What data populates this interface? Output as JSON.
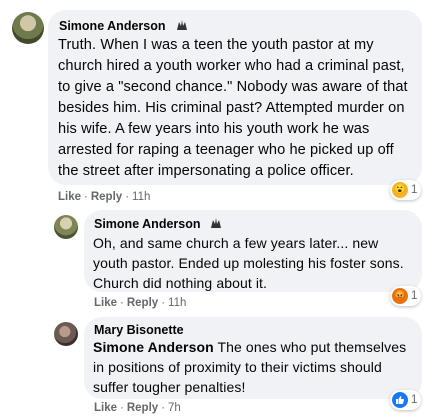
{
  "comments": [
    {
      "author": "Simone Anderson",
      "text": "Truth. When I was a teen the youth pastor at my church hired a youth worker who had a criminal past, to give a \"second chance.\" Nobody was aware of that besides him. His criminal past? Attempted murder on his wife. A few years into his youth work he was arrested for raping a teenager who he picked up off the street after impersonating a police officer.",
      "like_label": "Like",
      "reply_label": "Reply",
      "time": "11h",
      "reaction_count": "1",
      "reaction": "wow-emoji-icon"
    },
    {
      "author": "Simone Anderson",
      "text": "Oh, and same church a few years later... new youth pastor. Ended up molesting his foster sons. Church did nothing about it.",
      "like_label": "Like",
      "reply_label": "Reply",
      "time": "11h",
      "reaction_count": "1",
      "reaction": "angry-emoji-icon"
    },
    {
      "author": "Mary Bisonette",
      "mention": "Simone Anderson",
      "text": " The ones who put themselves in positions of proximity to their victims should suffer tougher penalties!",
      "like_label": "Like",
      "reply_label": "Reply",
      "time": "7h",
      "reaction_count": "1",
      "reaction": "like-thumb-icon"
    }
  ],
  "colors": {
    "bubble": "#f0f2f5",
    "meta": "#65676b",
    "like_blue": "#1877f2",
    "wow_yellow": "#f7b125",
    "angry_orange": "#e9710f"
  }
}
